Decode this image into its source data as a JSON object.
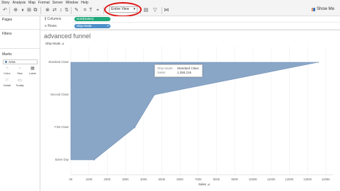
{
  "menu": {
    "items": [
      "Story",
      "Analysis",
      "Map",
      "Format",
      "Server",
      "Window",
      "Help"
    ]
  },
  "toolbar": {
    "view_select": "Entire View",
    "show_me": "Show Me"
  },
  "left_pane": {
    "pages_title": "Pages",
    "filters_title": "Filters",
    "marks_title": "Marks",
    "mark_type": "Area",
    "mark_buttons": [
      "Color",
      "Size",
      "Label",
      "Detail",
      "Tooltip"
    ]
  },
  "shelves": {
    "columns_label": "Columns",
    "rows_label": "Rows",
    "columns_pill": "SUM(Sales)",
    "rows_pill": "Ship Mode"
  },
  "sheet": {
    "title": "advanced funnel",
    "row_header": "Ship Mode",
    "x_axis_title": "Sales"
  },
  "tooltip": {
    "ship_mode_key": "Ship Mode:",
    "ship_mode_value": "Standard Class",
    "sales_key": "Sales:",
    "sales_value": "1,358,216"
  },
  "colors": {
    "area_fill": "#8aa6c6",
    "area_stroke": "#6f8fb6",
    "highlight": "#e01010"
  },
  "chart_data": {
    "type": "area",
    "orientation": "horizontal",
    "categories": [
      "Standard Class",
      "Second Class",
      "First Class",
      "Same Day"
    ],
    "values": [
      1358216,
      459194,
      351428,
      128363
    ],
    "xlabel": "Sales",
    "ylabel": "Ship Mode",
    "xlim": [
      0,
      1400000
    ],
    "x_ticks": [
      "0K",
      "100K",
      "200K",
      "300K",
      "400K",
      "500K",
      "600K",
      "700K",
      "800K",
      "900K",
      "1000K",
      "1100K",
      "1200K",
      "1300K",
      "1400K"
    ]
  }
}
